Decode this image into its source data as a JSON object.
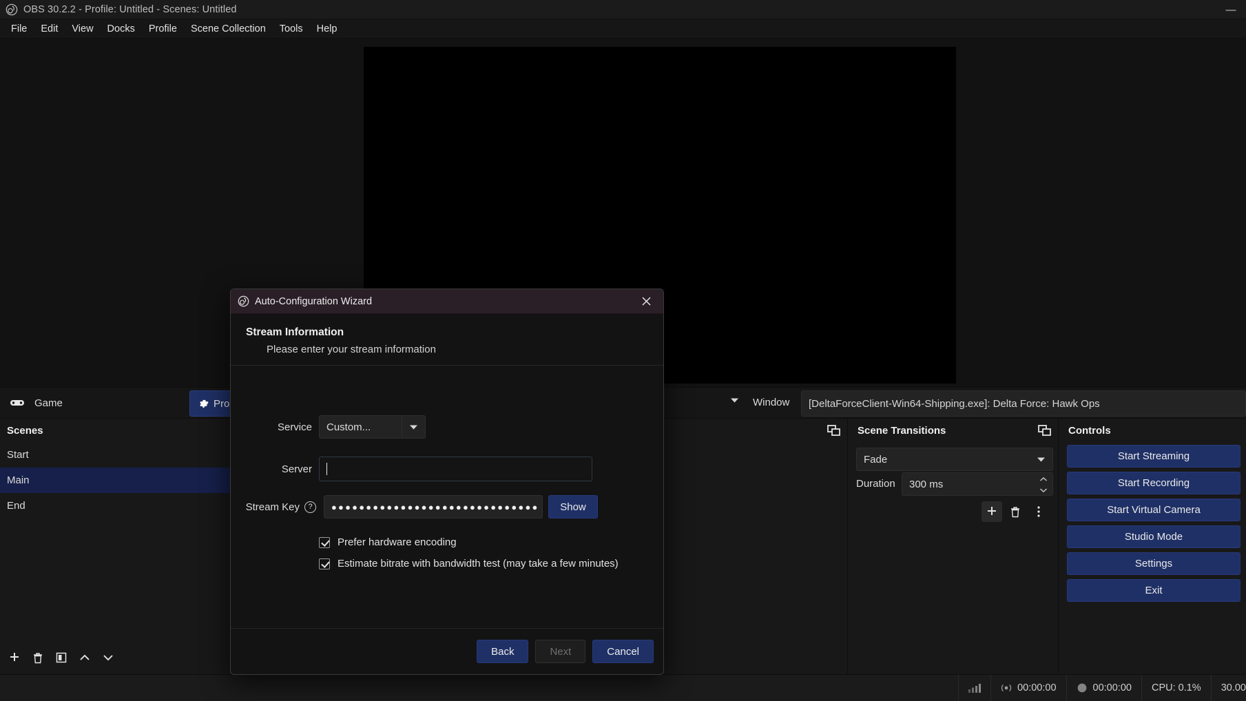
{
  "titlebar": {
    "title": "OBS 30.2.2 - Profile: Untitled - Scenes: Untitled",
    "logo_icon": "obs-logo-icon",
    "minimize_label": "—"
  },
  "menubar": {
    "items": [
      {
        "label": "File"
      },
      {
        "label": "Edit"
      },
      {
        "label": "View"
      },
      {
        "label": "Docks"
      },
      {
        "label": "Profile"
      },
      {
        "label": "Scene Collection"
      },
      {
        "label": "Tools"
      },
      {
        "label": "Help"
      }
    ]
  },
  "source_toolbar": {
    "gamepad_icon": "gamepad-icon",
    "source_label": "Game",
    "properties_label": "Properties",
    "gear_icon": "gear-icon",
    "caret_icon": "chevron-down-icon",
    "window_label": "Window",
    "window_value": "[DeltaForceClient-Win64-Shipping.exe]: Delta Force: Hawk Ops"
  },
  "scenes_dock": {
    "title": "Scenes",
    "float_icon": "undock-icon",
    "items": [
      {
        "label": "Start",
        "selected": false
      },
      {
        "label": "Main",
        "selected": true
      },
      {
        "label": "End",
        "selected": false
      }
    ],
    "toolbar": [
      {
        "name": "add-scene-button",
        "icon": "plus-icon"
      },
      {
        "name": "remove-scene-button",
        "icon": "trash-icon"
      },
      {
        "name": "scene-filters-button",
        "icon": "filters-icon"
      },
      {
        "name": "move-scene-up-button",
        "icon": "chevron-up-icon"
      },
      {
        "name": "move-scene-down-button",
        "icon": "chevron-down-icon"
      }
    ]
  },
  "sources_dock": {
    "title": "",
    "float_icon": "undock-icon"
  },
  "mixer_dock": {
    "title": "",
    "float_icon": "undock-icon"
  },
  "transitions_dock": {
    "title": "Scene Transitions",
    "float_icon": "undock-icon",
    "transition_value": "Fade",
    "caret_icon": "chevron-down-icon",
    "duration_label": "Duration",
    "duration_value": "300 ms",
    "buttons": [
      {
        "name": "add-transition-button",
        "icon": "plus-icon"
      },
      {
        "name": "remove-transition-button",
        "icon": "trash-icon"
      },
      {
        "name": "transition-properties-button",
        "icon": "kebab-menu-icon"
      }
    ]
  },
  "controls_dock": {
    "title": "Controls",
    "buttons": [
      {
        "label": "Start Streaming",
        "name": "start-streaming-button"
      },
      {
        "label": "Start Recording",
        "name": "start-recording-button"
      },
      {
        "label": "Start Virtual Camera",
        "name": "start-virtual-camera-button"
      },
      {
        "label": "Studio Mode",
        "name": "studio-mode-button"
      },
      {
        "label": "Settings",
        "name": "settings-button"
      },
      {
        "label": "Exit",
        "name": "exit-button"
      }
    ]
  },
  "statusbar": {
    "signal_icon": "signal-bars-icon",
    "stream_icon": "broadcast-icon",
    "stream_time": "00:00:00",
    "record_icon": "record-dot-icon",
    "record_time": "00:00:00",
    "cpu": "CPU: 0.1%",
    "fps": "30.00"
  },
  "dialog": {
    "logo_icon": "obs-logo-icon",
    "title": "Auto-Configuration Wizard",
    "close_icon": "close-icon",
    "heading": "Stream Information",
    "subheading": "Please enter your stream information",
    "service_label": "Service",
    "service_value": "Custom...",
    "service_caret_icon": "chevron-down-icon",
    "server_label": "Server",
    "server_value": "",
    "server_placeholder": "",
    "stream_key_label": "Stream Key",
    "stream_key_help_icon": "help-icon",
    "stream_key_value": "●●●●●●●●●●●●●●●●●●●●●●●●●●●●●●",
    "show_button_label": "Show",
    "checkbox_hardware_label": "Prefer hardware encoding",
    "checkbox_hardware_checked": true,
    "checkbox_bitrate_label": "Estimate bitrate with bandwidth test (may take a few minutes)",
    "checkbox_bitrate_checked": true,
    "back_label": "Back",
    "next_label": "Next",
    "cancel_label": "Cancel"
  },
  "colors": {
    "accent_blue": "#1f3066",
    "selection_blue": "#16204a",
    "dialog_titlebar": "#2a1f26",
    "window_bg": "#181818"
  }
}
